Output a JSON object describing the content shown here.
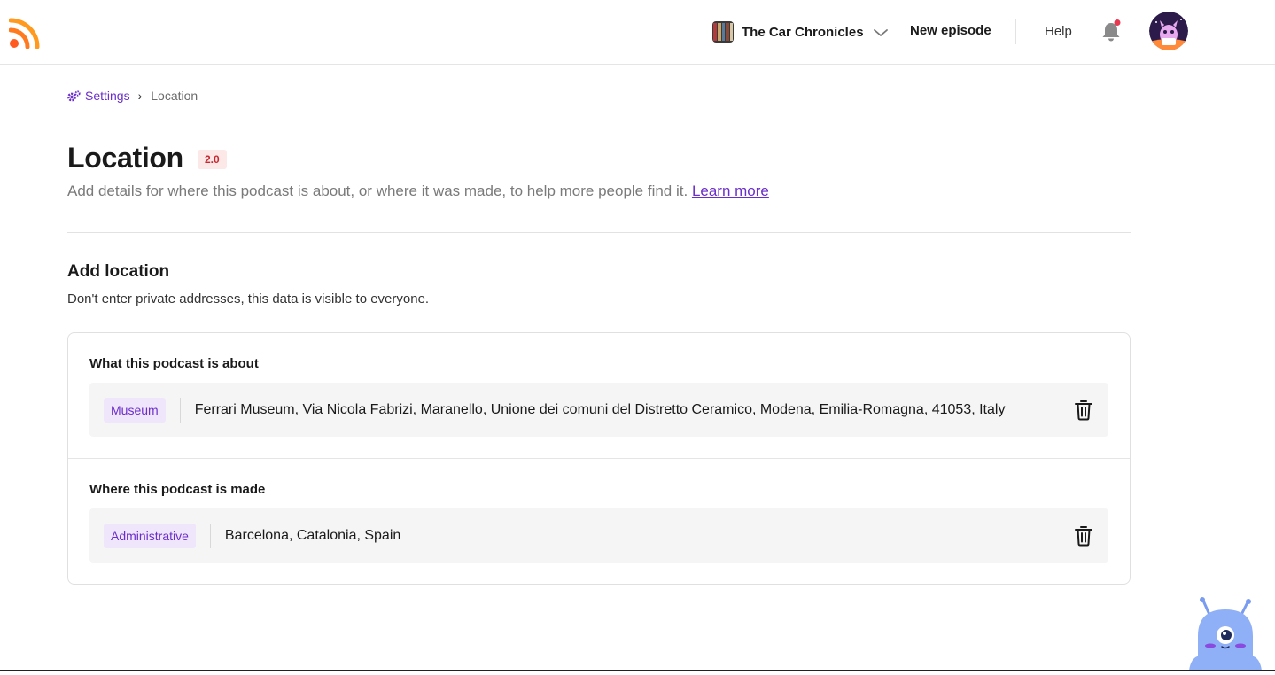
{
  "header": {
    "podcast_name": "The Car Chronicles",
    "new_episode_label": "New episode",
    "help_label": "Help",
    "notification_dot_color": "#e8384f",
    "brand_color": "#ff5a1f"
  },
  "breadcrumb": {
    "parent_label": "Settings",
    "separator": "›",
    "current_label": "Location"
  },
  "page": {
    "title": "Location",
    "version_badge": "2.0",
    "description": "Add details for where this podcast is about, or where it was made, to help more people find it. ",
    "learn_more_label": "Learn more"
  },
  "add_location": {
    "title": "Add location",
    "note": "Don't enter private addresses, this data is visible to everyone.",
    "groups": [
      {
        "label": "What this podcast is about",
        "tag": "Museum",
        "address": "Ferrari Museum, Via Nicola Fabrizi, Maranello, Unione dei comuni del Distretto Ceramico, Modena, Emilia-Romagna, 41053, Italy"
      },
      {
        "label": "Where this podcast is made",
        "tag": "Administrative",
        "address": "Barcelona, Catalonia, Spain"
      }
    ]
  },
  "icons": {
    "logo": "rss-logo-icon",
    "settings": "gear-icon",
    "chevron": "chevron-down-icon",
    "bell": "bell-icon",
    "delete": "trash-icon",
    "mascot": "mascot-icon"
  },
  "colors": {
    "accent": "#6b2fc9",
    "tag_bg": "#f0e6fb",
    "badge_bg": "#fde8e8",
    "badge_text": "#c8272f"
  }
}
